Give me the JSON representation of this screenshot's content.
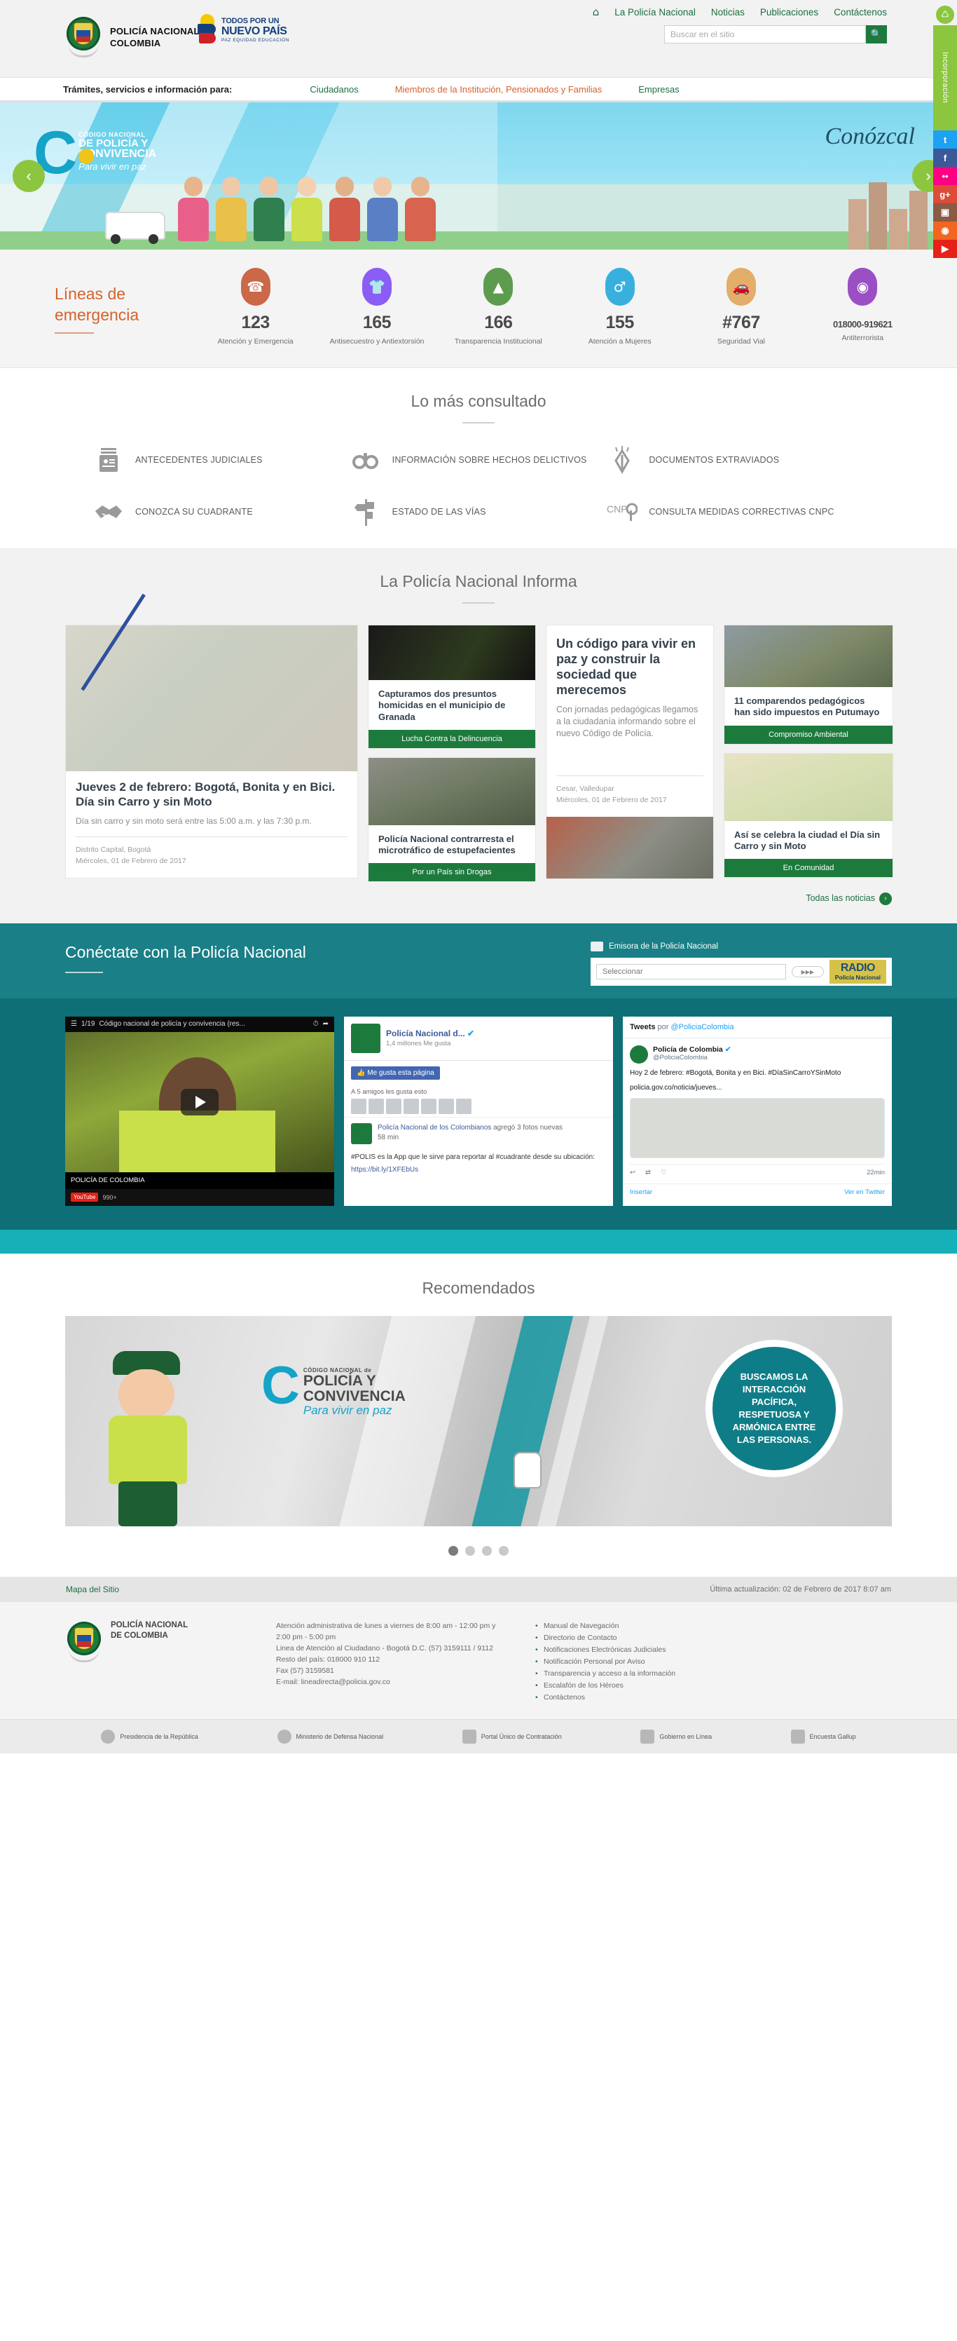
{
  "header": {
    "brand_line1": "POLICÍA NACIONAL DE",
    "brand_line2": "COLOMBIA",
    "gov_line1": "TODOS POR UN",
    "gov_line2": "NUEVO PAÍS",
    "gov_line3": "PAZ  EQUIDAD  EDUCACIÓN",
    "nav": [
      {
        "label": "La Policía Nacional",
        "name": "nav-la-policia-nacional"
      },
      {
        "label": "Noticias",
        "name": "nav-noticias"
      },
      {
        "label": "Publicaciones",
        "name": "nav-publicaciones"
      },
      {
        "label": "Contáctenos",
        "name": "nav-contactenos"
      }
    ],
    "home_icon": "home-icon",
    "search": {
      "placeholder": "Buscar en el sitio",
      "value": "",
      "button_icon": "search-icon"
    }
  },
  "tramites": {
    "label": "Trámites, servicios e información para:",
    "items": [
      {
        "label": "Ciudadanos",
        "active": false
      },
      {
        "label": "Miembros de la Institución, Pensionados y Familias",
        "active": true
      },
      {
        "label": "Empresas",
        "active": false
      }
    ]
  },
  "slider": {
    "cnpc_letter": "C",
    "line1": "CÓDIGO NACIONAL",
    "line2": "DE POLICÍA Y",
    "line3": "CONVIVENCIA",
    "line4": "Para vivir en paz",
    "headline": "Conózcal",
    "prev_icon": "chevron-left-icon",
    "next_icon": "chevron-right-icon"
  },
  "emergency": {
    "title": "Líneas de emergencia",
    "lines": [
      {
        "number": "123",
        "desc": "Atención y Emergencia",
        "color": "#cb6848",
        "icon": "phone-alert-icon"
      },
      {
        "number": "165",
        "desc": "Antisecuestro y Antiextorsión",
        "color": "#8b5cf6",
        "icon": "vest-icon"
      },
      {
        "number": "166",
        "desc": "Transparencia Institucional",
        "color": "#5d9c4e",
        "icon": "police-cap-icon"
      },
      {
        "number": "155",
        "desc": "Atención a Mujeres",
        "color": "#38b0dd",
        "icon": "woman-icon"
      },
      {
        "number": "#767",
        "desc": "Seguridad Vial",
        "color": "#e3ad6a",
        "icon": "car-icon"
      },
      {
        "number": "018000-919621",
        "desc": "Antiterrorista",
        "color": "#9b4fc4",
        "icon": "binoculars-icon",
        "small": true
      }
    ]
  },
  "consulted": {
    "title": "Lo más consultado",
    "items": [
      {
        "label": "ANTECEDENTES JUDICIALES",
        "icon": "id-card-icon"
      },
      {
        "label": "INFORMACIÓN SOBRE HECHOS DELICTIVOS",
        "icon": "handcuffs-icon"
      },
      {
        "label": "DOCUMENTOS EXTRAVIADOS",
        "icon": "documents-lost-icon"
      },
      {
        "label": "CONOZCA SU CUADRANTE",
        "icon": "handshake-icon"
      },
      {
        "label": "ESTADO DE LAS VÍAS",
        "icon": "road-sign-icon"
      },
      {
        "label": "CONSULTA MEDIDAS CORRECTIVAS CNPC",
        "icon": "cnpc-icon"
      }
    ]
  },
  "news": {
    "title": "La Policía Nacional Informa",
    "all_label": "Todas las noticias",
    "all_icon": "chevron-right-icon",
    "cards": [
      {
        "title": "Jueves 2 de febrero: Bogotá, Bonita y en Bici. Día sin Carro y sin Moto",
        "subtitle": "Día sin carro y sin moto será entre las 5:00 a.m. y las 7:30 p.m.",
        "meta_place": "Distrito Capital, Bogotá",
        "meta_date": "Miércoles, 01 de Febrero de 2017",
        "image": "map-bogota-road-closures"
      },
      {
        "title": "Capturamos dos presuntos homicidas en el municipio de Granada",
        "tag": "Lucha Contra la Delincuencia",
        "image": "night-crime-scene-photo"
      },
      {
        "title": "Policía Nacional contrarresta el microtráfico de estupefacientes",
        "tag": "Por un País sin Drogas",
        "image": "detainee-with-officers-photo"
      },
      {
        "title": "Un código para vivir en paz y construir la sociedad que merecemos",
        "subtitle": "Con jornadas pedagógicas llegamos a la ciudadanía informando sobre el nuevo Código de Policía.",
        "meta_place": "Cesar, Valledupar",
        "meta_date": "Miércoles, 01 de Febrero de 2017",
        "image": "street-crowd-photo"
      },
      {
        "title": "11 comparendos pedagógicos han sido impuestos en Putumayo",
        "tag": "Compromiso Ambiental",
        "image": "officers-ticket-photo"
      },
      {
        "title": "Así se celebra la ciudad el Día sin Carro y sin Moto",
        "tag": "En Comunidad",
        "image": "bogota-bike-routes-map"
      }
    ]
  },
  "connect": {
    "title": "Conéctate con la Policía Nacional",
    "radio_label": "Emisora de la Policía Nacional",
    "radio_select": "Seleccionar",
    "radio_logo_1": "RADIO",
    "radio_logo_2": "Policía Nacional",
    "speaker_icon": "speaker-icon",
    "youtube": {
      "counter": "1/19",
      "video_title": "Código nacional de policía y convivencia (res...",
      "channel": "POLICÍA DE COLOMBIA",
      "subscribers": "990+",
      "badge": "YouTube",
      "play_icon": "play-icon",
      "clock_icon": "clock-icon",
      "share_icon": "share-icon",
      "menu_icon": "playlist-icon"
    },
    "facebook": {
      "page_name": "Policía Nacional d...",
      "likes": "1,4 millones Me gusta",
      "like_button": "Me gusta esta página",
      "friends_text": "A 5 amigos les gusta esto",
      "post_author": "Policía Nacional de los Colombianos",
      "post_action": "agregó 3 fotos nuevas",
      "post_time": "58 min",
      "post_text": "#POLIS es la App que le sirve para reportar al #cuadrante desde su ubicación:",
      "post_link": "https://bit.ly/1XFEbUs",
      "verified_icon": "verified-icon",
      "thumbs_up_icon": "thumbs-up-icon"
    },
    "twitter": {
      "header_prefix": "Tweets",
      "header_mid": "por",
      "header_handle": "@PoliciaColombia",
      "name": "Policía de Colombia",
      "handle": "@PoliciaColombia",
      "verified_icon": "verified-icon",
      "text": "Hoy 2 de febrero: #Bogotá, Bonita y en Bici. #DíaSinCarroYSinMoto",
      "link": "policia.gov.co/noticia/jueves...",
      "time": "22min",
      "reply_icon": "reply-icon",
      "retweet_icon": "retweet-icon",
      "like_icon": "heart-icon",
      "footer_left": "Insertar",
      "footer_right": "Ver en Twitter"
    }
  },
  "recommended": {
    "title": "Recomendados",
    "banner": {
      "cnpc_letter": "C",
      "l1": "CÓDIGO NACIONAL de",
      "l2": "POLICÍA Y",
      "l3": "CONVIVENCIA",
      "l4": "Para vivir en paz",
      "circle_text": "BUSCAMOS LA INTERACCIÓN PACÍFICA, RESPETUOSA Y ARMÓNICA ENTRE LAS PERSONAS.",
      "hand_icon": "pointer-hand-icon"
    },
    "dots": 4,
    "active_dot": 0
  },
  "footer": {
    "sitemap": "Mapa del Sitio",
    "last_update": "Última actualización: 02 de Febrero de 2017 8:07 am",
    "brand_line1": "POLICÍA NACIONAL",
    "brand_line2": "DE COLOMBIA",
    "contact": "Atención administrativa de lunes a viernes de 8:00 am - 12:00 pm y 2:00 pm - 5:00 pm\nLinea de Atención al Ciudadano - Bogotá D.C. (57) 3159111 / 9112\nResto del país: 018000 910 112\nFax (57) 3159581\nE-mail: lineadirecta@policia.gov.co",
    "links": [
      "Manual de Navegación",
      "Directorio de Contacto",
      "Notificaciones Electrónicas Judiciales",
      "Notificación Personal por Aviso",
      "Transparencia y acceso a la información",
      "Escalafón de los Héroes",
      "Contáctenos"
    ],
    "logos": [
      {
        "label": "Presidencia de la República",
        "icon": "presidency-seal-icon"
      },
      {
        "label": "Ministerio de Defensa Nacional",
        "icon": "mindefensa-seal-icon"
      },
      {
        "label": "Portal Único de Contratación",
        "icon": "contratacion-icon"
      },
      {
        "label": "Gobierno en Línea",
        "icon": "gobierno-en-linea-icon"
      },
      {
        "label": "Encuesta Gallup",
        "icon": "gallup-icon"
      }
    ]
  },
  "rail": {
    "label": "Incorporación",
    "items": [
      {
        "icon": "twitter-icon",
        "color": "#1da1f2"
      },
      {
        "icon": "facebook-icon",
        "color": "#3b5998"
      },
      {
        "icon": "flickr-icon",
        "color": "#ff0084"
      },
      {
        "icon": "google-plus-icon",
        "color": "#dd4b39"
      },
      {
        "icon": "instagram-icon",
        "color": "#8a5a44"
      },
      {
        "icon": "rss-icon",
        "color": "#f26522"
      },
      {
        "icon": "youtube-icon",
        "color": "#e62117"
      }
    ],
    "top_icon": "cycle-icon"
  }
}
